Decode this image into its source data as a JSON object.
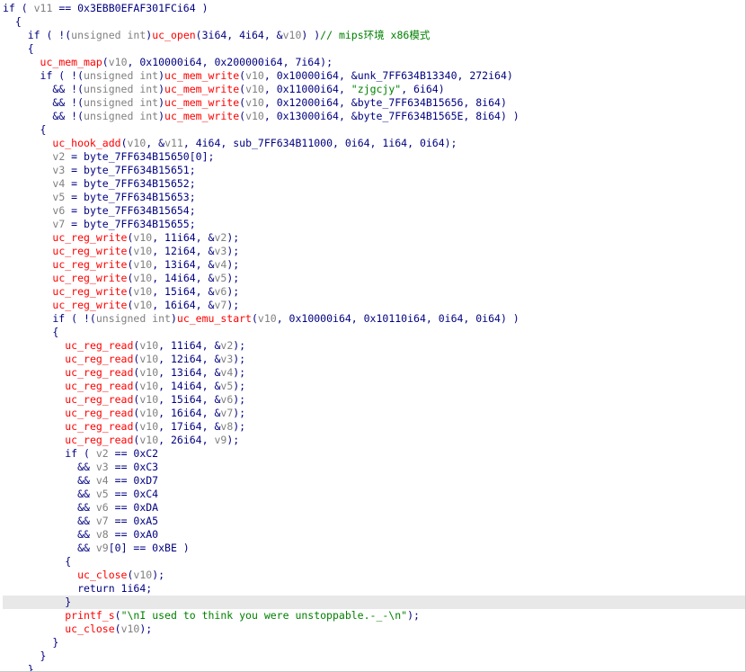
{
  "editor": {
    "lines": [
      {
        "parts": [
          {
            "t": "if ( "
          },
          {
            "t": "v11",
            "c": "var"
          },
          {
            "t": " == 0x3EBB0EFAF301FCi64 )"
          }
        ]
      },
      {
        "parts": [
          {
            "t": "  {"
          }
        ]
      },
      {
        "parts": [
          {
            "t": "    if ( !("
          },
          {
            "t": "unsigned int",
            "c": "ty"
          },
          {
            "t": ")"
          },
          {
            "t": "uc_open",
            "c": "fn"
          },
          {
            "t": "(3i64, 4i64, &"
          },
          {
            "t": "v10",
            "c": "var"
          },
          {
            "t": ") )"
          },
          {
            "t": "// mips环境 x86模式",
            "c": "cm"
          }
        ]
      },
      {
        "parts": [
          {
            "t": "    {"
          }
        ]
      },
      {
        "parts": [
          {
            "t": "      "
          },
          {
            "t": "uc_mem_map",
            "c": "fn"
          },
          {
            "t": "("
          },
          {
            "t": "v10",
            "c": "var"
          },
          {
            "t": ", 0x10000i64, 0x200000i64, 7i64);"
          }
        ]
      },
      {
        "parts": [
          {
            "t": "      if ( !("
          },
          {
            "t": "unsigned int",
            "c": "ty"
          },
          {
            "t": ")"
          },
          {
            "t": "uc_mem_write",
            "c": "fn"
          },
          {
            "t": "("
          },
          {
            "t": "v10",
            "c": "var"
          },
          {
            "t": ", 0x10000i64, &unk_7FF634B13340, 272i64)"
          }
        ]
      },
      {
        "parts": [
          {
            "t": "        && !("
          },
          {
            "t": "unsigned int",
            "c": "ty"
          },
          {
            "t": ")"
          },
          {
            "t": "uc_mem_write",
            "c": "fn"
          },
          {
            "t": "("
          },
          {
            "t": "v10",
            "c": "var"
          },
          {
            "t": ", 0x11000i64, "
          },
          {
            "t": "\"zjgcjy\"",
            "c": "str"
          },
          {
            "t": ", 6i64)"
          }
        ]
      },
      {
        "parts": [
          {
            "t": "        && !("
          },
          {
            "t": "unsigned int",
            "c": "ty"
          },
          {
            "t": ")"
          },
          {
            "t": "uc_mem_write",
            "c": "fn"
          },
          {
            "t": "("
          },
          {
            "t": "v10",
            "c": "var"
          },
          {
            "t": ", 0x12000i64, &byte_7FF634B15656, 8i64)"
          }
        ]
      },
      {
        "parts": [
          {
            "t": "        && !("
          },
          {
            "t": "unsigned int",
            "c": "ty"
          },
          {
            "t": ")"
          },
          {
            "t": "uc_mem_write",
            "c": "fn"
          },
          {
            "t": "("
          },
          {
            "t": "v10",
            "c": "var"
          },
          {
            "t": ", 0x13000i64, &byte_7FF634B1565E, 8i64) )"
          }
        ]
      },
      {
        "parts": [
          {
            "t": "      {"
          }
        ]
      },
      {
        "parts": [
          {
            "t": "        "
          },
          {
            "t": "uc_hook_add",
            "c": "fn"
          },
          {
            "t": "("
          },
          {
            "t": "v10",
            "c": "var"
          },
          {
            "t": ", &"
          },
          {
            "t": "v11",
            "c": "var"
          },
          {
            "t": ", 4i64, sub_7FF634B11000, 0i64, 1i64, 0i64);"
          }
        ]
      },
      {
        "parts": [
          {
            "t": "        "
          },
          {
            "t": "v2",
            "c": "var"
          },
          {
            "t": " = byte_7FF634B15650[0];"
          }
        ]
      },
      {
        "parts": [
          {
            "t": "        "
          },
          {
            "t": "v3",
            "c": "var"
          },
          {
            "t": " = byte_7FF634B15651;"
          }
        ]
      },
      {
        "parts": [
          {
            "t": "        "
          },
          {
            "t": "v4",
            "c": "var"
          },
          {
            "t": " = byte_7FF634B15652;"
          }
        ]
      },
      {
        "parts": [
          {
            "t": "        "
          },
          {
            "t": "v5",
            "c": "var"
          },
          {
            "t": " = byte_7FF634B15653;"
          }
        ]
      },
      {
        "parts": [
          {
            "t": "        "
          },
          {
            "t": "v6",
            "c": "var"
          },
          {
            "t": " = byte_7FF634B15654;"
          }
        ]
      },
      {
        "parts": [
          {
            "t": "        "
          },
          {
            "t": "v7",
            "c": "var"
          },
          {
            "t": " = byte_7FF634B15655;"
          }
        ]
      },
      {
        "parts": [
          {
            "t": "        "
          },
          {
            "t": "uc_reg_write",
            "c": "fn"
          },
          {
            "t": "("
          },
          {
            "t": "v10",
            "c": "var"
          },
          {
            "t": ", 11i64, &"
          },
          {
            "t": "v2",
            "c": "var"
          },
          {
            "t": ");"
          }
        ]
      },
      {
        "parts": [
          {
            "t": "        "
          },
          {
            "t": "uc_reg_write",
            "c": "fn"
          },
          {
            "t": "("
          },
          {
            "t": "v10",
            "c": "var"
          },
          {
            "t": ", 12i64, &"
          },
          {
            "t": "v3",
            "c": "var"
          },
          {
            "t": ");"
          }
        ]
      },
      {
        "parts": [
          {
            "t": "        "
          },
          {
            "t": "uc_reg_write",
            "c": "fn"
          },
          {
            "t": "("
          },
          {
            "t": "v10",
            "c": "var"
          },
          {
            "t": ", 13i64, &"
          },
          {
            "t": "v4",
            "c": "var"
          },
          {
            "t": ");"
          }
        ]
      },
      {
        "parts": [
          {
            "t": "        "
          },
          {
            "t": "uc_reg_write",
            "c": "fn"
          },
          {
            "t": "("
          },
          {
            "t": "v10",
            "c": "var"
          },
          {
            "t": ", 14i64, &"
          },
          {
            "t": "v5",
            "c": "var"
          },
          {
            "t": ");"
          }
        ]
      },
      {
        "parts": [
          {
            "t": "        "
          },
          {
            "t": "uc_reg_write",
            "c": "fn"
          },
          {
            "t": "("
          },
          {
            "t": "v10",
            "c": "var"
          },
          {
            "t": ", 15i64, &"
          },
          {
            "t": "v6",
            "c": "var"
          },
          {
            "t": ");"
          }
        ]
      },
      {
        "parts": [
          {
            "t": "        "
          },
          {
            "t": "uc_reg_write",
            "c": "fn"
          },
          {
            "t": "("
          },
          {
            "t": "v10",
            "c": "var"
          },
          {
            "t": ", 16i64, &"
          },
          {
            "t": "v7",
            "c": "var"
          },
          {
            "t": ");"
          }
        ]
      },
      {
        "parts": [
          {
            "t": "        if ( !("
          },
          {
            "t": "unsigned int",
            "c": "ty"
          },
          {
            "t": ")"
          },
          {
            "t": "uc_emu_start",
            "c": "fn"
          },
          {
            "t": "("
          },
          {
            "t": "v10",
            "c": "var"
          },
          {
            "t": ", 0x10000i64, 0x10110i64, 0i64, 0i64) )"
          }
        ]
      },
      {
        "parts": [
          {
            "t": "        {"
          }
        ]
      },
      {
        "parts": [
          {
            "t": "          "
          },
          {
            "t": "uc_reg_read",
            "c": "fn"
          },
          {
            "t": "("
          },
          {
            "t": "v10",
            "c": "var"
          },
          {
            "t": ", 11i64, &"
          },
          {
            "t": "v2",
            "c": "var"
          },
          {
            "t": ");"
          }
        ]
      },
      {
        "parts": [
          {
            "t": "          "
          },
          {
            "t": "uc_reg_read",
            "c": "fn"
          },
          {
            "t": "("
          },
          {
            "t": "v10",
            "c": "var"
          },
          {
            "t": ", 12i64, &"
          },
          {
            "t": "v3",
            "c": "var"
          },
          {
            "t": ");"
          }
        ]
      },
      {
        "parts": [
          {
            "t": "          "
          },
          {
            "t": "uc_reg_read",
            "c": "fn"
          },
          {
            "t": "("
          },
          {
            "t": "v10",
            "c": "var"
          },
          {
            "t": ", 13i64, &"
          },
          {
            "t": "v4",
            "c": "var"
          },
          {
            "t": ");"
          }
        ]
      },
      {
        "parts": [
          {
            "t": "          "
          },
          {
            "t": "uc_reg_read",
            "c": "fn"
          },
          {
            "t": "("
          },
          {
            "t": "v10",
            "c": "var"
          },
          {
            "t": ", 14i64, &"
          },
          {
            "t": "v5",
            "c": "var"
          },
          {
            "t": ");"
          }
        ]
      },
      {
        "parts": [
          {
            "t": "          "
          },
          {
            "t": "uc_reg_read",
            "c": "fn"
          },
          {
            "t": "("
          },
          {
            "t": "v10",
            "c": "var"
          },
          {
            "t": ", 15i64, &"
          },
          {
            "t": "v6",
            "c": "var"
          },
          {
            "t": ");"
          }
        ]
      },
      {
        "parts": [
          {
            "t": "          "
          },
          {
            "t": "uc_reg_read",
            "c": "fn"
          },
          {
            "t": "("
          },
          {
            "t": "v10",
            "c": "var"
          },
          {
            "t": ", 16i64, &"
          },
          {
            "t": "v7",
            "c": "var"
          },
          {
            "t": ");"
          }
        ]
      },
      {
        "parts": [
          {
            "t": "          "
          },
          {
            "t": "uc_reg_read",
            "c": "fn"
          },
          {
            "t": "("
          },
          {
            "t": "v10",
            "c": "var"
          },
          {
            "t": ", 17i64, &"
          },
          {
            "t": "v8",
            "c": "var"
          },
          {
            "t": ");"
          }
        ]
      },
      {
        "parts": [
          {
            "t": "          "
          },
          {
            "t": "uc_reg_read",
            "c": "fn"
          },
          {
            "t": "("
          },
          {
            "t": "v10",
            "c": "var"
          },
          {
            "t": ", 26i64, "
          },
          {
            "t": "v9",
            "c": "var"
          },
          {
            "t": ");"
          }
        ]
      },
      {
        "parts": [
          {
            "t": "          if ( "
          },
          {
            "t": "v2",
            "c": "var"
          },
          {
            "t": " == 0xC2"
          }
        ]
      },
      {
        "parts": [
          {
            "t": "            && "
          },
          {
            "t": "v3",
            "c": "var"
          },
          {
            "t": " == 0xC3"
          }
        ]
      },
      {
        "parts": [
          {
            "t": "            && "
          },
          {
            "t": "v4",
            "c": "var"
          },
          {
            "t": " == 0xD7"
          }
        ]
      },
      {
        "parts": [
          {
            "t": "            && "
          },
          {
            "t": "v5",
            "c": "var"
          },
          {
            "t": " == 0xC4"
          }
        ]
      },
      {
        "parts": [
          {
            "t": "            && "
          },
          {
            "t": "v6",
            "c": "var"
          },
          {
            "t": " == 0xDA"
          }
        ]
      },
      {
        "parts": [
          {
            "t": "            && "
          },
          {
            "t": "v7",
            "c": "var"
          },
          {
            "t": " == 0xA5"
          }
        ]
      },
      {
        "parts": [
          {
            "t": "            && "
          },
          {
            "t": "v8",
            "c": "var"
          },
          {
            "t": " == 0xA0"
          }
        ]
      },
      {
        "parts": [
          {
            "t": "            && "
          },
          {
            "t": "v9",
            "c": "var"
          },
          {
            "t": "[0] == 0xBE )"
          }
        ]
      },
      {
        "parts": [
          {
            "t": "          {"
          }
        ]
      },
      {
        "parts": [
          {
            "t": "            "
          },
          {
            "t": "uc_close",
            "c": "fn"
          },
          {
            "t": "("
          },
          {
            "t": "v10",
            "c": "var"
          },
          {
            "t": ");"
          }
        ]
      },
      {
        "parts": [
          {
            "t": "            return 1i64;"
          }
        ]
      },
      {
        "parts": [
          {
            "t": "          }"
          }
        ],
        "highlight": true
      },
      {
        "parts": [
          {
            "t": "          "
          },
          {
            "t": "printf_s",
            "c": "fn"
          },
          {
            "t": "("
          },
          {
            "t": "\"\\nI used to think you were unstoppable.-_-\\n\"",
            "c": "str"
          },
          {
            "t": ");"
          }
        ]
      },
      {
        "parts": [
          {
            "t": "          "
          },
          {
            "t": "uc_close",
            "c": "fn"
          },
          {
            "t": "("
          },
          {
            "t": "v10",
            "c": "var"
          },
          {
            "t": ");"
          }
        ]
      },
      {
        "parts": [
          {
            "t": "        }"
          }
        ]
      },
      {
        "parts": [
          {
            "t": "      }"
          }
        ]
      },
      {
        "parts": [
          {
            "t": "    }"
          }
        ]
      }
    ]
  }
}
